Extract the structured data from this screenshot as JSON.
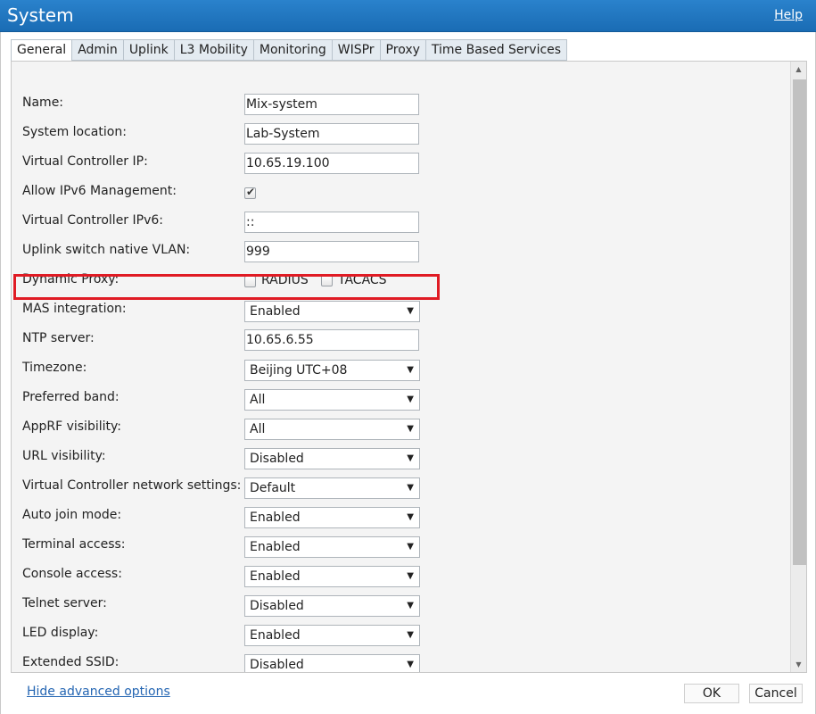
{
  "window": {
    "title": "System",
    "help_label": "Help"
  },
  "tabs": [
    {
      "label": "General",
      "active": true
    },
    {
      "label": "Admin"
    },
    {
      "label": "Uplink"
    },
    {
      "label": "L3 Mobility"
    },
    {
      "label": "Monitoring"
    },
    {
      "label": "WISPr"
    },
    {
      "label": "Proxy"
    },
    {
      "label": "Time Based Services"
    }
  ],
  "form": {
    "name": {
      "label": "Name:",
      "value": "Mix-system"
    },
    "system_location": {
      "label": "System location:",
      "value": "Lab-System"
    },
    "vc_ip": {
      "label": "Virtual Controller IP:",
      "value": "10.65.19.100"
    },
    "allow_ipv6": {
      "label": "Allow IPv6 Management:",
      "checked": true
    },
    "vc_ipv6": {
      "label": "Virtual Controller IPv6:",
      "value": "::"
    },
    "uplink_vlan": {
      "label": "Uplink switch native VLAN:",
      "value": "999"
    },
    "dynamic_proxy": {
      "label": "Dynamic Proxy:",
      "radius_label": "RADIUS",
      "tacacs_label": "TACACS",
      "radius_checked": false,
      "tacacs_checked": false
    },
    "mas_integration": {
      "label": "MAS integration:",
      "value": "Enabled"
    },
    "ntp_server": {
      "label": "NTP server:",
      "value": "10.65.6.55"
    },
    "timezone": {
      "label": "Timezone:",
      "value": "Beijing UTC+08"
    },
    "preferred_band": {
      "label": "Preferred band:",
      "value": "All"
    },
    "apprf_visibility": {
      "label": "AppRF visibility:",
      "value": "All"
    },
    "url_visibility": {
      "label": "URL visibility:",
      "value": "Disabled"
    },
    "vc_network_settings": {
      "label": "Virtual Controller network settings:",
      "value": "Default"
    },
    "auto_join": {
      "label": "Auto join mode:",
      "value": "Enabled"
    },
    "terminal_access": {
      "label": "Terminal access:",
      "value": "Enabled"
    },
    "console_access": {
      "label": "Console access:",
      "value": "Enabled"
    },
    "telnet_server": {
      "label": "Telnet server:",
      "value": "Disabled"
    },
    "led_display": {
      "label": "LED display:",
      "value": "Enabled"
    },
    "extended_ssid": {
      "label": "Extended SSID:",
      "value": "Disabled"
    }
  },
  "footer": {
    "hide_advanced_label": "Hide advanced options",
    "ok_label": "OK",
    "cancel_label": "Cancel"
  },
  "colors": {
    "titlebar": "#1f74be",
    "highlight": "#e01b24",
    "link": "#2566b3"
  },
  "icons": {
    "dropdown": "caret-down-icon",
    "scroll_up": "arrow-up-icon",
    "scroll_down": "arrow-down-icon"
  }
}
